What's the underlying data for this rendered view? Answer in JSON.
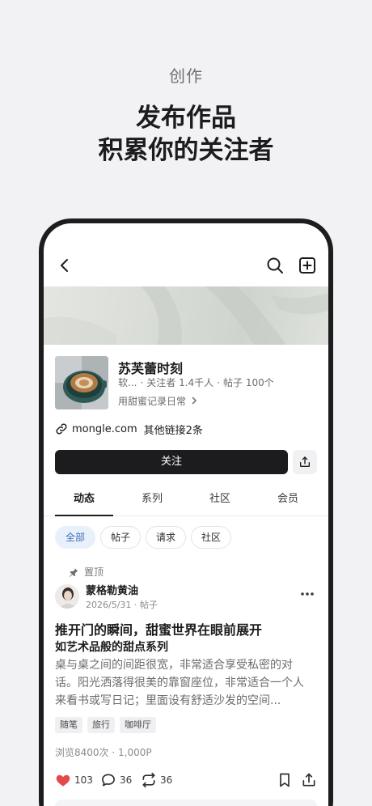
{
  "promo": {
    "kicker": "创作",
    "title_line1": "发布作品",
    "title_line2": "积累你的关注者"
  },
  "nav": {
    "back_icon": "chevron-left-icon",
    "search_icon": "search-icon",
    "add_icon": "plus-square-icon"
  },
  "profile": {
    "name": "苏芙蕾时刻",
    "category": "软...",
    "followers": "关注者 1.4千人",
    "posts": "帖子 100个",
    "bio": "用甜蜜记录日常",
    "link": "mongle.com",
    "other_links": "其他链接2条",
    "follow_label": "关注"
  },
  "tabs": [
    {
      "label": "动态",
      "active": true
    },
    {
      "label": "系列",
      "active": false
    },
    {
      "label": "社区",
      "active": false
    },
    {
      "label": "会员",
      "active": false
    }
  ],
  "filters": [
    {
      "label": "全部",
      "active": true
    },
    {
      "label": "帖子",
      "active": false
    },
    {
      "label": "请求",
      "active": false
    },
    {
      "label": "社区",
      "active": false
    }
  ],
  "post": {
    "pinned_label": "置顶",
    "author": "蒙格勒黄油",
    "date": "2026/5/31",
    "type": "帖子",
    "title": "推开门的瞬间，甜蜜世界在眼前展开",
    "subtitle": "如艺术品般的甜点系列",
    "body": "桌与桌之间的间距很宽，非常适合享受私密的对话。阳光洒落得很美的靠窗座位，非常适合一个人来看书或写日记；里面设有舒适沙发的空间...",
    "tags": [
      "随笔",
      "旅行",
      "咖啡厅"
    ],
    "views": "浏览8400次",
    "price": "1,000P",
    "likes": "103",
    "comments": "36",
    "reposts": "36"
  },
  "colors": {
    "accent_blue": "#3f6fb8",
    "like_red": "#e5484d",
    "dark": "#1c1c1e"
  }
}
